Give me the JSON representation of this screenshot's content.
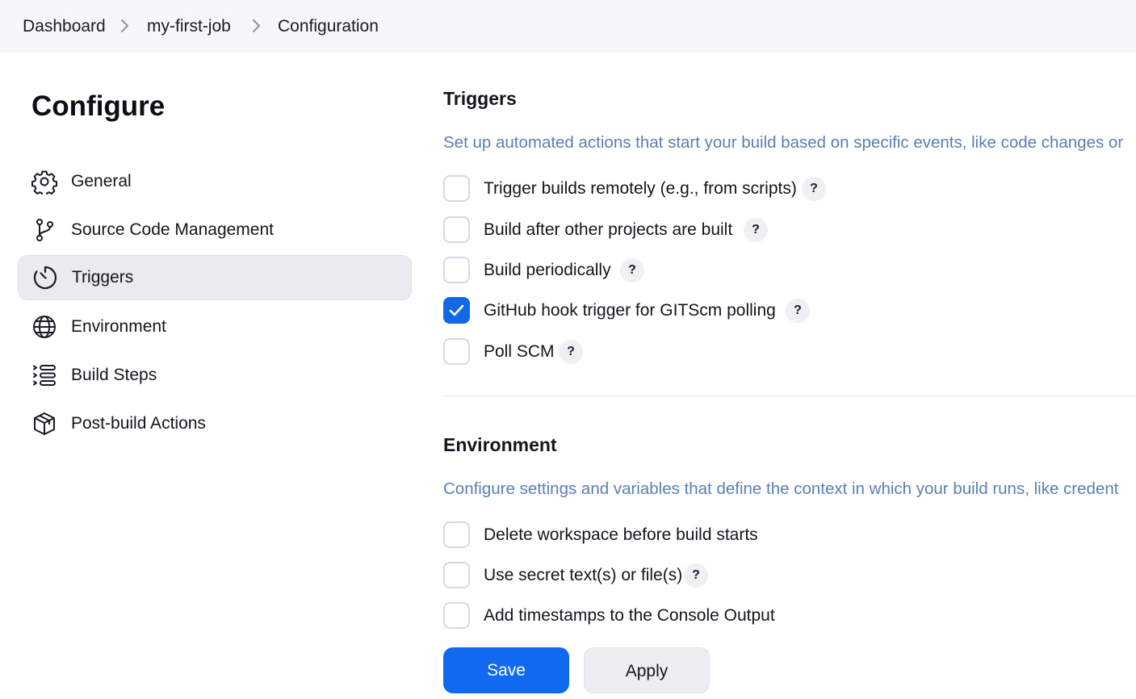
{
  "breadcrumb": {
    "items": [
      "Dashboard",
      "my-first-job",
      "Configuration"
    ]
  },
  "sidebar": {
    "title": "Configure",
    "items": [
      {
        "label": "General",
        "icon": "gear-icon"
      },
      {
        "label": "Source Code Management",
        "icon": "git-branch-icon"
      },
      {
        "label": "Triggers",
        "icon": "timer-icon",
        "active": true
      },
      {
        "label": "Environment",
        "icon": "globe-icon"
      },
      {
        "label": "Build Steps",
        "icon": "list-steps-icon"
      },
      {
        "label": "Post-build Actions",
        "icon": "package-icon"
      }
    ]
  },
  "triggers": {
    "title": "Triggers",
    "description": "Set up automated actions that start your build based on specific events, like code changes or",
    "options": [
      {
        "label": "Trigger builds remotely (e.g., from scripts)",
        "checked": false,
        "help": "?"
      },
      {
        "label": "Build after other projects are built",
        "checked": false,
        "help": "?"
      },
      {
        "label": "Build periodically",
        "checked": false,
        "help": "?"
      },
      {
        "label": "GitHub hook trigger for GITScm polling",
        "checked": true,
        "help": "?"
      },
      {
        "label": "Poll SCM",
        "checked": false,
        "help": "?"
      }
    ]
  },
  "environment": {
    "title": "Environment",
    "description": "Configure settings and variables that define the context in which your build runs, like credent",
    "options": [
      {
        "label": "Delete workspace before build starts",
        "checked": false
      },
      {
        "label": "Use secret text(s) or file(s)",
        "checked": false,
        "help": "?"
      },
      {
        "label": "Add timestamps to the Console Output",
        "checked": false
      }
    ]
  },
  "actions": {
    "save_label": "Save",
    "apply_label": "Apply"
  },
  "colors": {
    "accent": "#1368e8",
    "description_text": "#5b7fb3",
    "active_nav_bg": "#e9ebf0"
  }
}
